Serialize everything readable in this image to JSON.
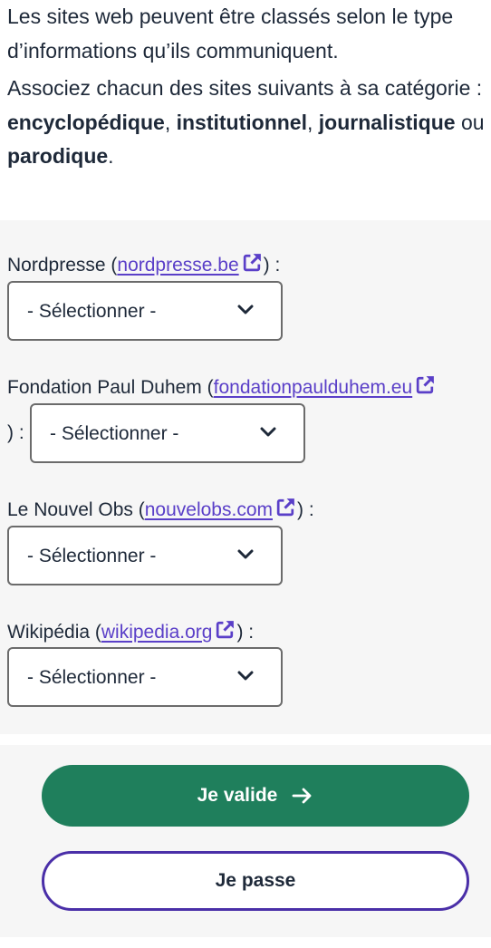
{
  "intro": {
    "line1": "Les sites web peuvent être classés selon le type d’informations qu’ils communiquent.",
    "line2_start": "Associez chacun des sites suivants à sa catégorie : ",
    "cat1": "encyclopédique",
    "sep1": ", ",
    "cat2": "institutionnel",
    "sep2": ", ",
    "cat3": "journalistique",
    "sep3": " ou ",
    "cat4": "parodique",
    "end": "."
  },
  "questions": [
    {
      "name": "Nordpresse (",
      "link": "nordpresse.be",
      "suffix": ") :",
      "select": "- Sélectionner -"
    },
    {
      "name": "Fondation Paul Duhem (",
      "link": "fondationpaulduhem.eu",
      "suffix": ") :",
      "select": "- Sélectionner -"
    },
    {
      "name": "Le Nouvel Obs (",
      "link": "nouvelobs.com",
      "suffix": ") :",
      "select": "- Sélectionner -"
    },
    {
      "name": "Wikipédia (",
      "link": "wikipedia.org",
      "suffix": ") :",
      "select": "- Sélectionner -"
    }
  ],
  "icons": {
    "external_link": "external-link-icon",
    "dropdown": "chevron-down-icon",
    "submit_arrow": "arrow-right-icon"
  },
  "actions": {
    "validate_label": "Je valide",
    "skip_label": "Je passe"
  },
  "colors": {
    "text": "#1e2939",
    "link": "#5a3fc8",
    "primary_button": "#1f7f5c",
    "secondary_border": "#4a2fa8",
    "panel_bg": "#f6f6f6"
  }
}
